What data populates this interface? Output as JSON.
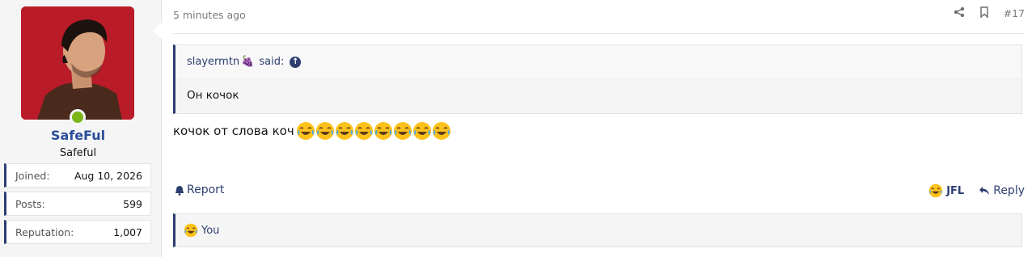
{
  "user": {
    "username": "SafeFul",
    "title": "Safeful",
    "stats": [
      {
        "label": "Joined:",
        "value": "Aug 10, 2026"
      },
      {
        "label": "Posts:",
        "value": "599"
      },
      {
        "label": "Reputation:",
        "value": "1,007"
      }
    ],
    "online": true
  },
  "post": {
    "time": "5 minutes ago",
    "number": "#17",
    "quote": {
      "author": "slayermtn",
      "author_badge": "🍇",
      "said_label": "said:",
      "text": "Он кочок"
    },
    "message_text": "кочок от слова коч",
    "emoji": [
      "joy",
      "joy",
      "joy",
      "joy",
      "joy",
      "joy",
      "joy",
      "joy"
    ],
    "report_label": "Report",
    "reaction_label": "JFL",
    "reply_label": "Reply",
    "reactions_summary": "You"
  },
  "colors": {
    "accent": "#2c3e70",
    "username": "#2c4d9a",
    "online": "#7cb518",
    "avatar_bg": "#b01826"
  }
}
